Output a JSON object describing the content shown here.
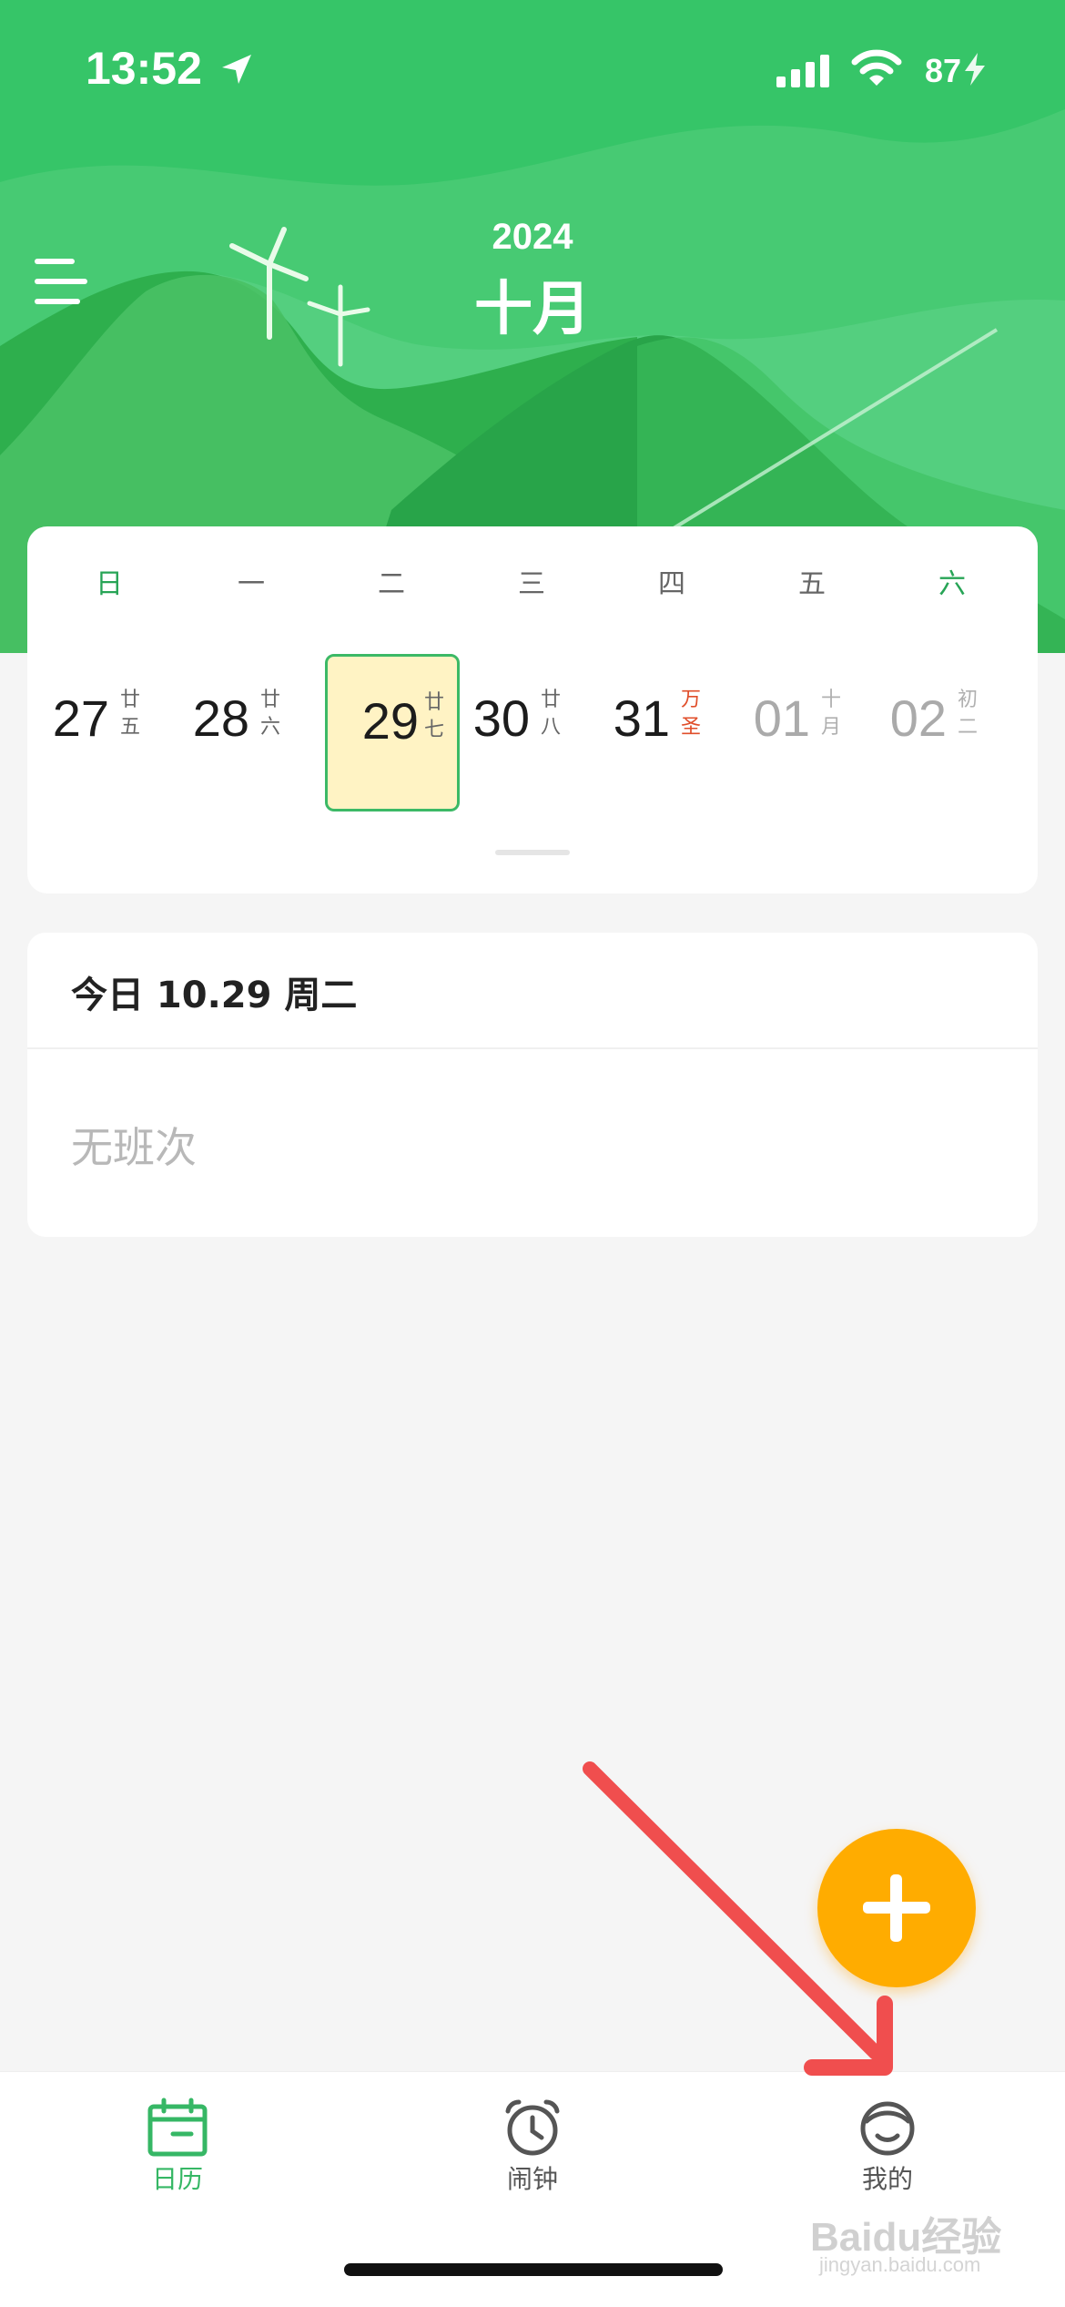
{
  "status": {
    "time": "13:52",
    "battery": "87"
  },
  "header": {
    "year": "2024",
    "month": "十月"
  },
  "calendar": {
    "weekdays": [
      "日",
      "一",
      "二",
      "三",
      "四",
      "五",
      "六"
    ],
    "days": [
      {
        "num": "27",
        "lunar_top": "廿",
        "lunar_bottom": "五"
      },
      {
        "num": "28",
        "lunar_top": "廿",
        "lunar_bottom": "六"
      },
      {
        "num": "29",
        "lunar_top": "廿",
        "lunar_bottom": "七",
        "selected": true
      },
      {
        "num": "30",
        "lunar_top": "廿",
        "lunar_bottom": "八"
      },
      {
        "num": "31",
        "lunar_top": "万",
        "lunar_bottom": "圣"
      },
      {
        "num": "01",
        "lunar_top": "十",
        "lunar_bottom": "月"
      },
      {
        "num": "02",
        "lunar_top": "初",
        "lunar_bottom": "二"
      }
    ]
  },
  "today": {
    "title": "今日 10.29 周二",
    "shift": "无班次"
  },
  "tabs": [
    {
      "label": "日历",
      "active": true
    },
    {
      "label": "闹钟",
      "active": false
    },
    {
      "label": "我的",
      "active": false
    }
  ],
  "watermark": {
    "main": "Baidu经验",
    "sub": "jingyan.baidu.com"
  },
  "colors": {
    "primary": "#36c568",
    "fab": "#ffac00",
    "selected_bg": "#fff3c4",
    "holiday": "#e04e2a",
    "annotation": "#f04e4e"
  },
  "icons": [
    "location-arrow-icon",
    "cellular-signal-icon",
    "wifi-icon",
    "charging-icon",
    "menu-icon",
    "windmill-icon",
    "plus-icon",
    "calendar-icon",
    "alarm-clock-icon",
    "profile-icon"
  ]
}
